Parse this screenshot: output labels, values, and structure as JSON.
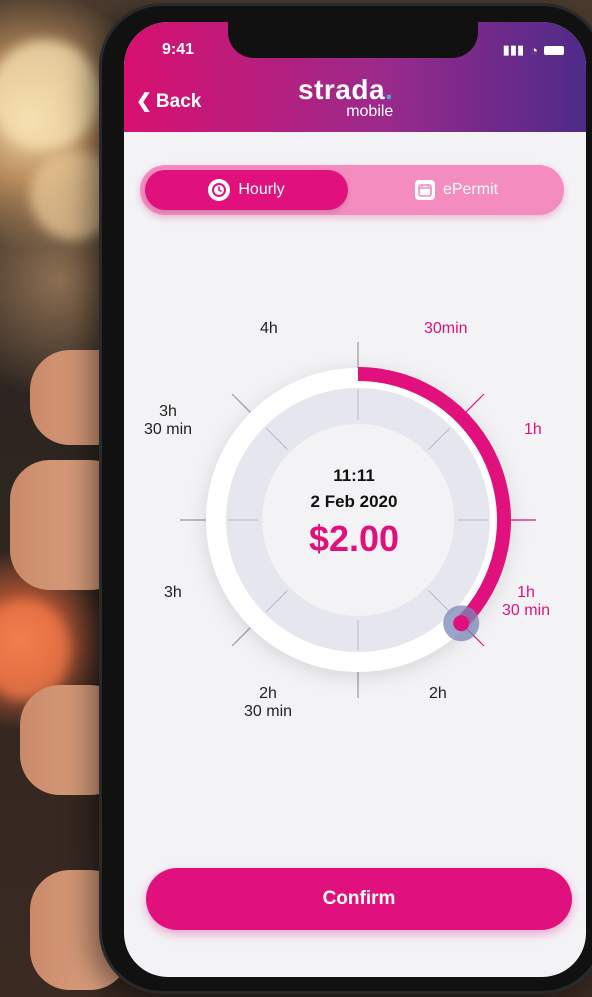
{
  "status_bar": {
    "time": "9:41"
  },
  "header": {
    "back_label": "Back",
    "logo_main": "strada",
    "logo_sub": "mobile"
  },
  "tabs": [
    {
      "label": "Hourly",
      "icon": "clock-icon",
      "selected": true
    },
    {
      "label": "ePermit",
      "icon": "calendar-icon",
      "selected": false
    }
  ],
  "dial": {
    "labels": {
      "min30": "30min",
      "h1": "1h",
      "h1_30a": "1h",
      "h1_30b": "30 min",
      "h2": "2h",
      "h2_30a": "2h",
      "h2_30b": "30 min",
      "h3": "3h",
      "h3_30a": "3h",
      "h3_30b": "30 min",
      "h4": "4h"
    },
    "selected_duration_hours": 1.5,
    "max_hours": 4
  },
  "summary": {
    "time": "11:11",
    "date": "2 Feb 2020",
    "price": "$2.00"
  },
  "confirm_label": "Confirm",
  "colors": {
    "accent": "#e0117c",
    "header_start": "#d8106f",
    "header_end": "#4d2b8a"
  }
}
